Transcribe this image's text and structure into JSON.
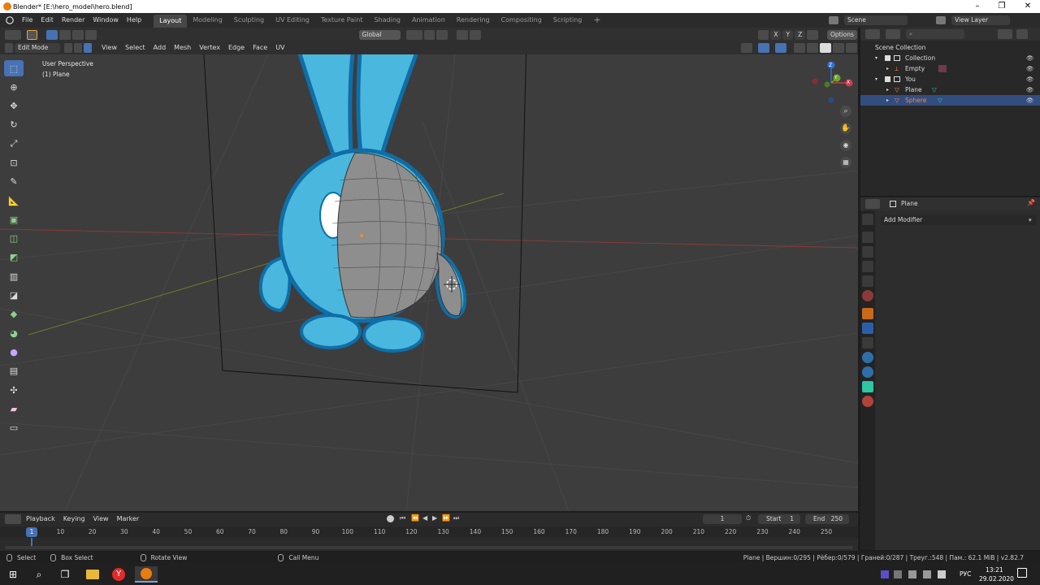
{
  "window": {
    "title": "Blender* [E:\\hero_model\\hero.blend]"
  },
  "menu": {
    "items": [
      "File",
      "Edit",
      "Render",
      "Window",
      "Help"
    ]
  },
  "workspaces": [
    "Layout",
    "Modeling",
    "Sculpting",
    "UV Editing",
    "Texture Paint",
    "Shading",
    "Animation",
    "Rendering",
    "Compositing",
    "Scripting"
  ],
  "active_workspace": "Layout",
  "scene": {
    "name": "Scene",
    "view_layer": "View Layer"
  },
  "viewport_header": {
    "orientation": "Global",
    "options": "Options"
  },
  "editor_header": {
    "mode": "Edit Mode",
    "menus": [
      "View",
      "Select",
      "Add",
      "Mesh",
      "Vertex",
      "Edge",
      "Face",
      "UV"
    ]
  },
  "viewport": {
    "perspective": "User Perspective",
    "object": "(1) Plane"
  },
  "gizmo": {
    "x": "X",
    "y": "Y",
    "z": "Z"
  },
  "outliner": {
    "root": "Scene Collection",
    "rows": [
      {
        "label": "Collection",
        "kind": "collection"
      },
      {
        "label": "Empty",
        "kind": "object"
      },
      {
        "label": "You",
        "kind": "collection"
      },
      {
        "label": "Plane",
        "kind": "object"
      },
      {
        "label": "Sphere",
        "kind": "object"
      }
    ]
  },
  "properties": {
    "object": "Plane",
    "add_modifier": "Add Modifier"
  },
  "timeline": {
    "menus": [
      "Playback",
      "Keying",
      "View",
      "Marker"
    ],
    "current_frame": "1",
    "start_label": "Start",
    "start": "1",
    "end_label": "End",
    "end": "250",
    "ticks": [
      "10",
      "20",
      "30",
      "40",
      "50",
      "60",
      "70",
      "80",
      "90",
      "100",
      "110",
      "120",
      "130",
      "140",
      "150",
      "160",
      "170",
      "180",
      "190",
      "200",
      "210",
      "220",
      "230",
      "240",
      "250"
    ],
    "playhead": "1"
  },
  "statusbar": {
    "select": "Select",
    "box_select": "Box Select",
    "rotate_view": "Rotate View",
    "call_menu": "Call Menu",
    "stats": "Plane | Вершин:0/295 | Рёбер:0/579 | Граней:0/287 | Треуг.:548 | Пам.: 62.1 MiB | v2.82.7"
  },
  "taskbar": {
    "lang": "РУС",
    "time": "13:21",
    "date": "29.02.2020"
  },
  "colors": {
    "accent": "#4772b3",
    "char_blue": "#4ab8de",
    "char_outline": "#0f6ea8",
    "selected_orange": "#f28a3b"
  }
}
